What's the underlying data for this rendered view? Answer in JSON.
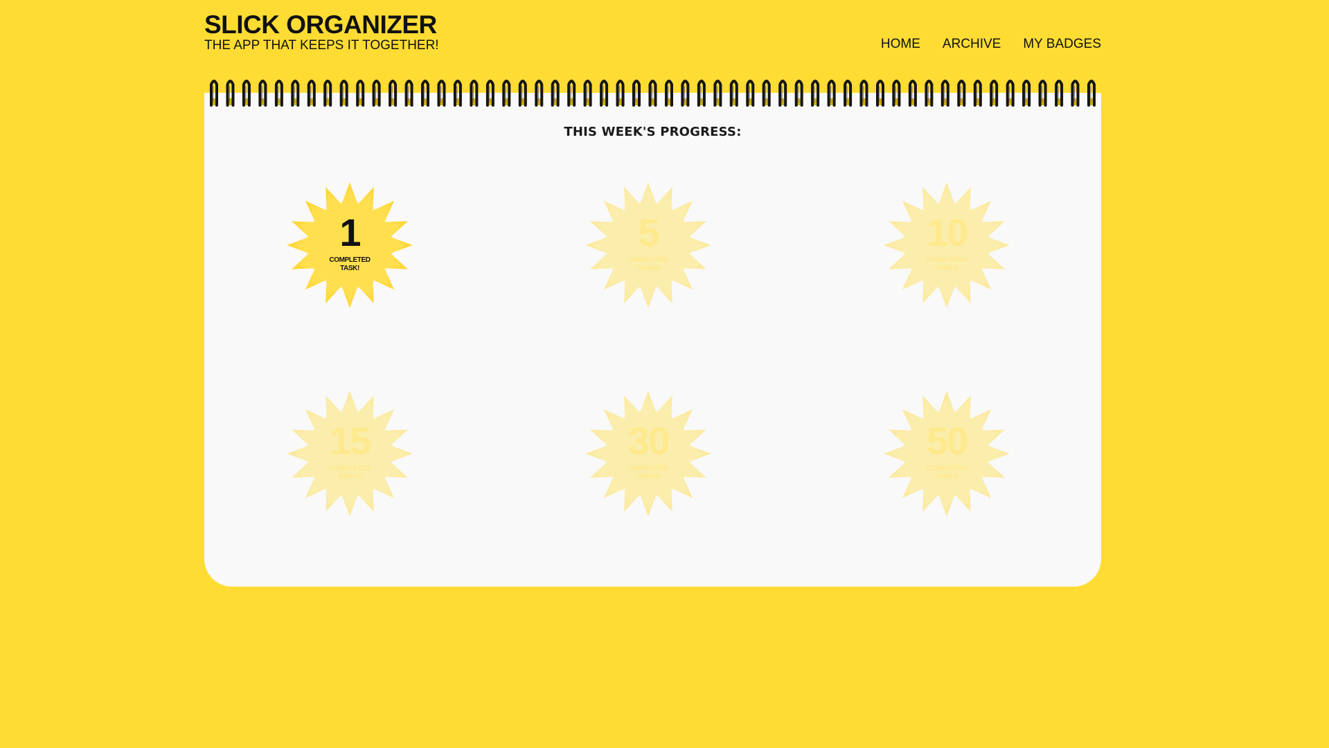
{
  "header": {
    "title": "SLICK ORGANIZER",
    "tagline": "THE APP THAT KEEPS IT TOGETHER!"
  },
  "nav": {
    "items": [
      {
        "label": "HOME"
      },
      {
        "label": "ARCHIVE"
      },
      {
        "label": "MY BADGES"
      }
    ]
  },
  "main": {
    "heading": "THIS WEEK'S PROGRESS:",
    "badges": [
      {
        "count": "1",
        "caption_line1": "COMPLETED",
        "caption_line2": "TASK!",
        "earned": true
      },
      {
        "count": "5",
        "caption_line1": "COMPLETED",
        "caption_line2": "TASKS!",
        "earned": false
      },
      {
        "count": "10",
        "caption_line1": "COMPLETED",
        "caption_line2": "TASKS!",
        "earned": false
      },
      {
        "count": "15",
        "caption_line1": "COMPLETED",
        "caption_line2": "TASKS!",
        "earned": false
      },
      {
        "count": "30",
        "caption_line1": "COMPLETED",
        "caption_line2": "TASKS!",
        "earned": false
      },
      {
        "count": "50",
        "caption_line1": "COMPLETED",
        "caption_line2": "TASKS!",
        "earned": false
      }
    ]
  },
  "colors": {
    "background": "#ffdc33",
    "notebook": "#f9f9f9",
    "badge_star": "#ffd83a",
    "text": "#111111"
  },
  "icons": {
    "spiral": "spiral-binding-icon",
    "badge": "starburst-badge-icon"
  }
}
